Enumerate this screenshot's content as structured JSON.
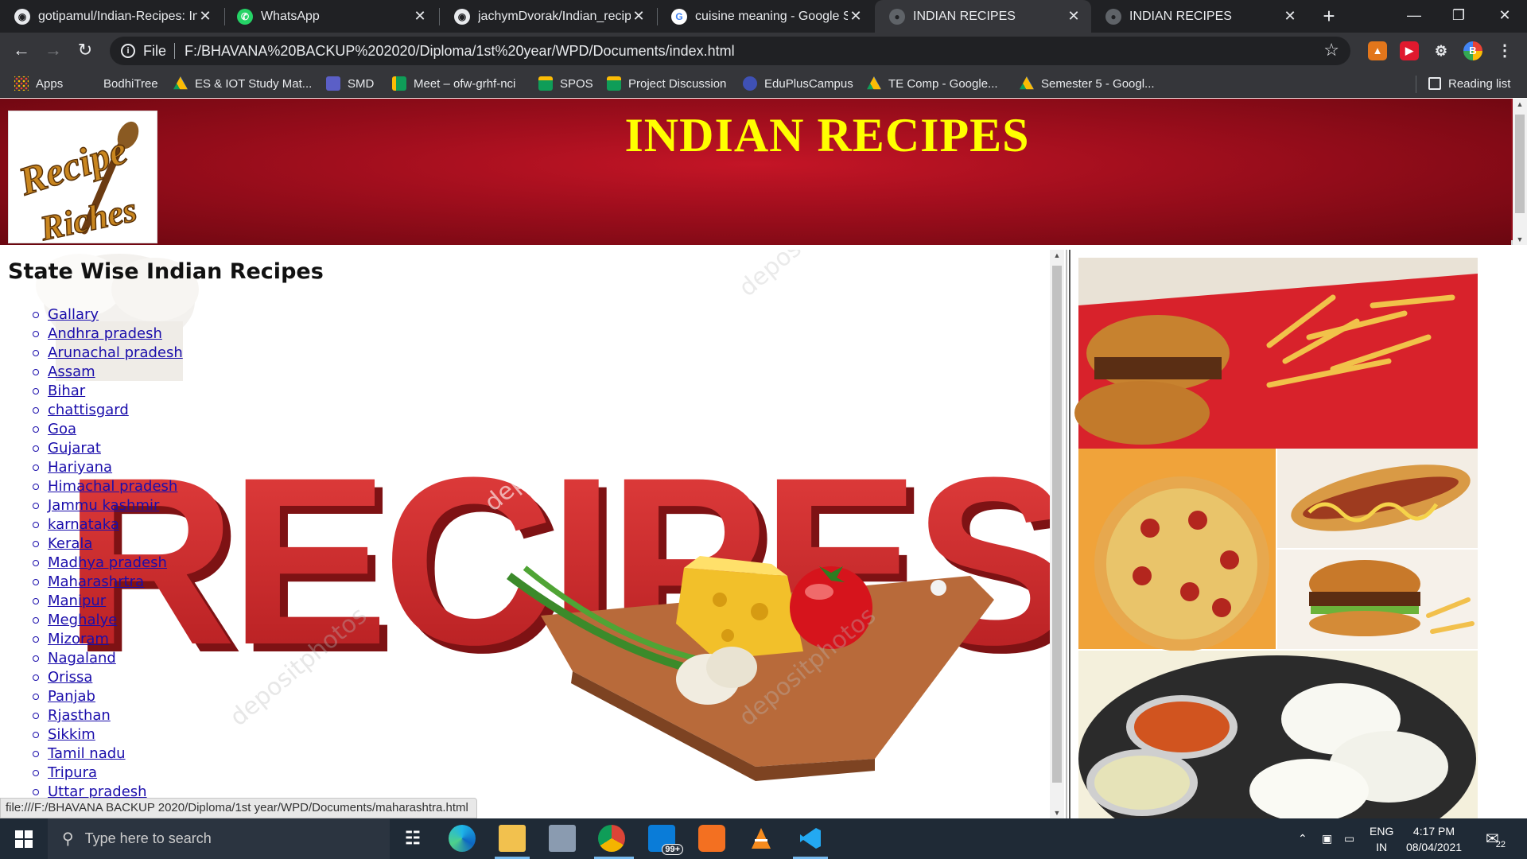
{
  "browser": {
    "tabs": [
      {
        "title": "gotipamul/Indian-Recipes: In",
        "icon": "github-icon"
      },
      {
        "title": "WhatsApp",
        "icon": "whatsapp-icon"
      },
      {
        "title": "jachymDvorak/Indian_recipe",
        "icon": "github-icon"
      },
      {
        "title": "cuisine meaning - Google Se",
        "icon": "google-icon"
      },
      {
        "title": "INDIAN RECIPES",
        "icon": "globe-icon",
        "active": true
      },
      {
        "title": "INDIAN RECIPES",
        "icon": "globe-icon"
      }
    ],
    "new_tab": "+",
    "address": {
      "scheme_label": "File",
      "url": "F:/BHAVANA%20BACKUP%202020/Diploma/1st%20year/WPD/Documents/index.html"
    },
    "bookmarks": [
      {
        "label": "Apps",
        "icon": "apps-grid-icon"
      },
      {
        "label": "BodhiTree",
        "icon": "none"
      },
      {
        "label": "ES & IOT Study Mat...",
        "icon": "drive-icon"
      },
      {
        "label": "SMD",
        "icon": "teams-icon"
      },
      {
        "label": "Meet – ofw-grhf-nci",
        "icon": "meet-icon"
      },
      {
        "label": "SPOS",
        "icon": "classroom-icon"
      },
      {
        "label": "Project Discussion",
        "icon": "classroom-icon"
      },
      {
        "label": "EduPlusCampus",
        "icon": "eduplus-icon"
      },
      {
        "label": "TE Comp - Google...",
        "icon": "drive-icon"
      },
      {
        "label": "Semester 5 - Googl...",
        "icon": "drive-icon"
      }
    ],
    "reading_list": "Reading list",
    "status_url": "file:///F:/BHAVANA BACKUP 2020/Diploma/1st year/WPD/Documents/maharashtra.html"
  },
  "page": {
    "site_title": "INDIAN RECIPES",
    "logo_text": [
      "Recipe",
      "Riches"
    ],
    "background_art_text": "RECIPES",
    "watermark": "depositphotos",
    "heading": "State Wise Indian Recipes",
    "states": [
      "Gallary",
      "Andhra pradesh",
      "Arunachal pradesh",
      "Assam",
      "Bihar",
      "chattisgard",
      "Goa",
      "Gujarat",
      "Hariyana",
      "Himachal pradesh",
      "Jammu kashmir",
      "karnataka",
      "Kerala",
      "Madhya pradesh",
      "Maharashrtra",
      "Manipur",
      "Meghalye",
      "Mizoram",
      "Nagaland",
      "Orissa",
      "Panjab",
      "Rjasthan",
      "Sikkim",
      "Tamil nadu",
      "Tripura",
      "Uttar pradesh"
    ],
    "gallery_images": [
      "burgers-and-fries-photo",
      "pizza-photo",
      "hotdog-photo",
      "burger-photo",
      "idli-sambar-photo"
    ]
  },
  "taskbar": {
    "search_placeholder": "Type here to search",
    "mail_badge": "99+",
    "language": [
      "ENG",
      "IN"
    ],
    "time": "4:17 PM",
    "date": "08/04/2021",
    "notifications": "22"
  },
  "colors": {
    "header_red": "#a00e1d",
    "title_yellow": "#ffff00",
    "link_blue": "#1a0dab",
    "chrome_dark": "#202124",
    "chrome_bar": "#35363a"
  }
}
